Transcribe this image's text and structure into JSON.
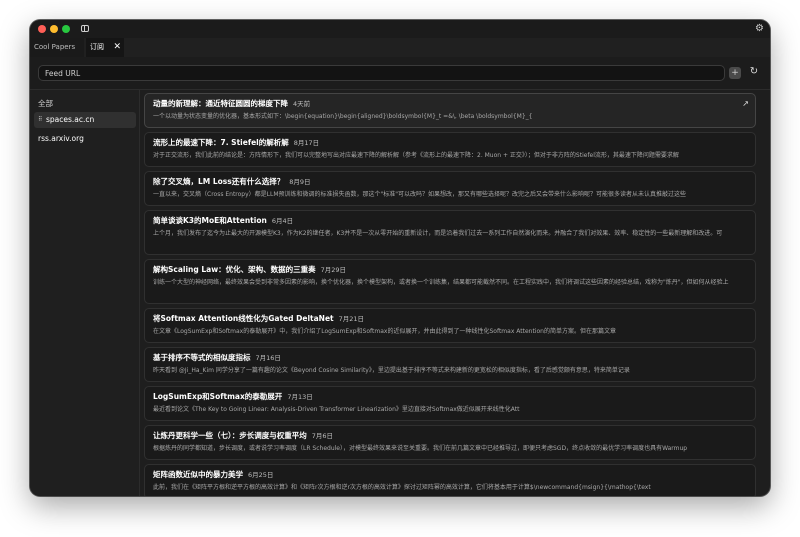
{
  "window": {
    "controls": [
      "close",
      "minimize",
      "zoom"
    ]
  },
  "tabs": [
    {
      "label": "Cool Papers"
    },
    {
      "label": "订阅",
      "close": "✕"
    }
  ],
  "urlbar": {
    "placeholder": "Feed URL",
    "add_label": "+",
    "refresh_label": "↻"
  },
  "sidebar": {
    "all_label": "全部",
    "items": [
      {
        "label": "spaces.ac.cn"
      },
      {
        "label": "rss.arxiv.org"
      }
    ]
  },
  "articles": [
    {
      "title": "动量的新理解：通近特征圆圆的梯度下降",
      "date": "4天前",
      "desc": "一个以动量为状态变量的优化器，基本形式如下：\\begin{equation}\\begin{aligned}\\boldsymbol{M}_t =&\\, \\beta \\boldsymbol{M}_{"
    },
    {
      "title": "流形上的最速下降：7. Stiefel的解析解",
      "date": "8月17日",
      "desc": "对于正交流形，我们此前的结论是：方阵情形下，我们可以完整地写出对应最速下降的解析解（参考《流形上的最速下降：2. Muon + 正交》）；但对于非方阵的Stiefel流形，其最速下降问题需要求解"
    },
    {
      "title": "除了交叉熵，LM Loss还有什么选择？",
      "date": "8月9日",
      "desc": "一直以来，交叉熵（Cross Entropy）都是LLM预训练和微调的标准损失函数，那这个\"标准\"可以改吗？如果想改，那又有哪些选择呢？改完之后又会带来什么影响呢？可能很多读者从未认真推敲过这些"
    },
    {
      "title": "简单谈谈K3的MoE和Attention",
      "date": "6月4日",
      "desc": "上个月，我们发布了迄今为止最大的开源模型K3，作为K2的继任者，K3并不是一次从零开始的重新设计，而是沿着我们过去一系列工作自然演化而来。并融合了我们对效果、效率、稳定性的一些最新理解和改进。可"
    },
    {
      "title": "解构Scaling Law：优化、架构、数据的三重奏",
      "date": "7月29日",
      "desc": "训练一个大型的神经网络，最终效果会受到非常多因素的影响，换个优化器，换个模型架构，或者换一个训练集，结果都可能截然不同。在工程实践中，我们将调试这些因素的经验总结，戏称为\"炼丹\"，但如何从经验上"
    },
    {
      "title": "将Softmax Attention线性化为Gated DeltaNet",
      "date": "7月21日",
      "desc": "在文章《LogSumExp和Softmax的泰勒展开》中，我们介绍了LogSumExp和Softmax的近似展开，并由此得到了一种线性化Softmax Attention的简单方案。但在那篇文章"
    },
    {
      "title": "基于排序不等式的相似度指标",
      "date": "7月16日",
      "desc": "昨天看到 @Ji_Ha_Kim 同学分享了一篇有趣的论文《Beyond Cosine Similarity》，里边提出基于排序不等式来构建新的更宽松的相似度指标，看了后感觉颇有意思，特来简单记录"
    },
    {
      "title": "LogSumExp和Softmax的泰勒展开",
      "date": "7月13日",
      "desc": "最近看到论文《The Key to Going Linear: Analysis-Driven Transformer Linearization》里边直接对Softmax做近似展开来线性化Att"
    },
    {
      "title": "让炼丹更科学一些（七）：步长调度与权重平均",
      "date": "7月6日",
      "desc": "根据炼丹的同学都知道，步长调度，或者说学习率调度（LR Schedule），对模型最终效果来说至关重要。我们在前几篇文章中已经推导过，即便只考虑SGD，终点收敛的最优学习率调度也具有Warmup"
    },
    {
      "title": "矩阵函数近似中的暴力美学",
      "date": "6月25日",
      "desc": "此前，我们在《矩阵平方根和逆平方根的高效计算》和《矩阵r次方根和逆r次方根的高效计算》探讨过矩阵幂的高效计算，它们将基本用于计算$\\newcommand{msign}{\\mathop{\\text"
    }
  ]
}
